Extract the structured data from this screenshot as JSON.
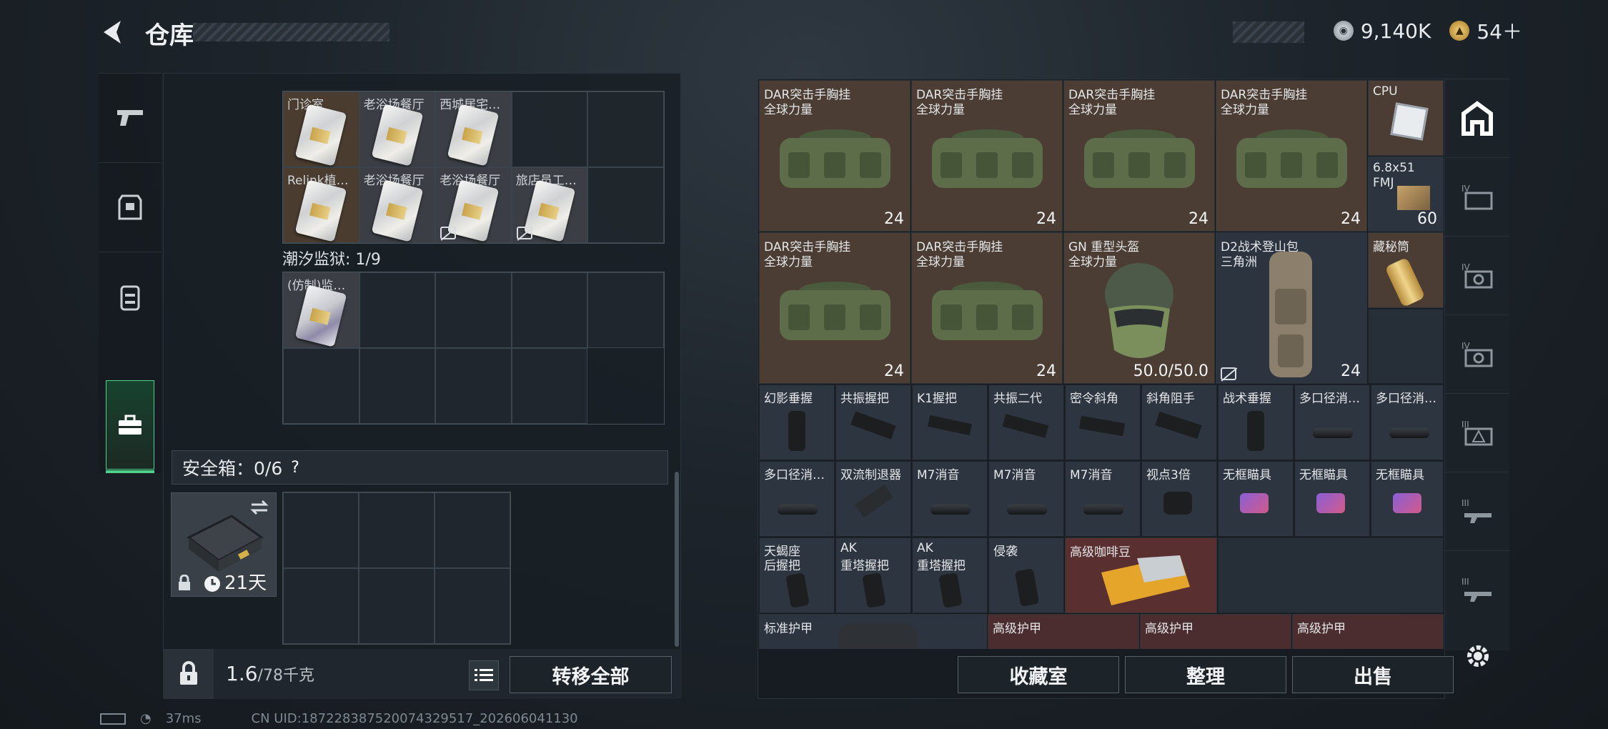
{
  "header": {
    "title": "仓库",
    "currency1": "9,140K",
    "currency2": "54＋"
  },
  "left": {
    "top_row1": [
      "门诊室",
      "老浴场餐厅",
      "西城居宅…",
      "",
      ""
    ],
    "top_row2": [
      "Relink植…",
      "老浴场餐厅",
      "老浴场餐厅",
      "旅店员工…",
      ""
    ],
    "tide_title": "潮汐监狱: 1/9",
    "tide_items": [
      "(仿制)监…"
    ],
    "safe_title": "安全箱：0/6",
    "safe_help": "?",
    "safe_days": "21天",
    "weight_value": "1.6",
    "weight_unit": "/78千克",
    "transfer_all": "转移全部"
  },
  "right": {
    "bags": [
      {
        "l1": "DAR突击手胸挂",
        "l2": "全球力量",
        "count": "24"
      },
      {
        "l1": "DAR突击手胸挂",
        "l2": "全球力量",
        "count": "24"
      },
      {
        "l1": "DAR突击手胸挂",
        "l2": "全球力量",
        "count": "24"
      },
      {
        "l1": "DAR突击手胸挂",
        "l2": "全球力量",
        "count": "24"
      },
      {
        "l1": "DAR突击手胸挂",
        "l2": "全球力量",
        "count": "24"
      },
      {
        "l1": "DAR突击手胸挂",
        "l2": "全球力量",
        "count": "24"
      }
    ],
    "helmet": {
      "l1": "GN 重型头盔",
      "l2": "全球力量",
      "durability": "50.0/50.0"
    },
    "backpack": {
      "l1": "D2战术登山包",
      "l2": "三角洲",
      "count": "24"
    },
    "cpu": "CPU",
    "ammo": {
      "l1": "6.8x51",
      "l2": "FMJ",
      "count": "60"
    },
    "cylinder": "藏秘筒",
    "row3": [
      "幻影垂握",
      "共振握把",
      "K1握把",
      "共振二代",
      "密令斜角",
      "斜角阻手",
      "战术垂握",
      "多口径消…",
      "多口径消…"
    ],
    "row4": [
      "多口径消…",
      "双流制退器",
      "M7消音",
      "M7消音",
      "M7消音",
      "视点3倍",
      "无框瞄具",
      "无框瞄具",
      "无框瞄具"
    ],
    "row5": [
      {
        "l1": "天蝎座",
        "l2": "后握把"
      },
      {
        "l1": "AK",
        "l2": "重塔握把"
      },
      {
        "l1": "AK",
        "l2": "重塔握把"
      },
      {
        "l1": "侵袭",
        "l2": ""
      }
    ],
    "coffee": "高级咖啡豆",
    "row6": [
      "标准护甲",
      "高级护甲",
      "高级护甲",
      "高级护甲"
    ],
    "buttons": [
      "收藏室",
      "整理",
      "出售"
    ]
  },
  "status": {
    "ping": "37ms",
    "uid": "CN UID:1872283875200743295​17_202606041130"
  }
}
